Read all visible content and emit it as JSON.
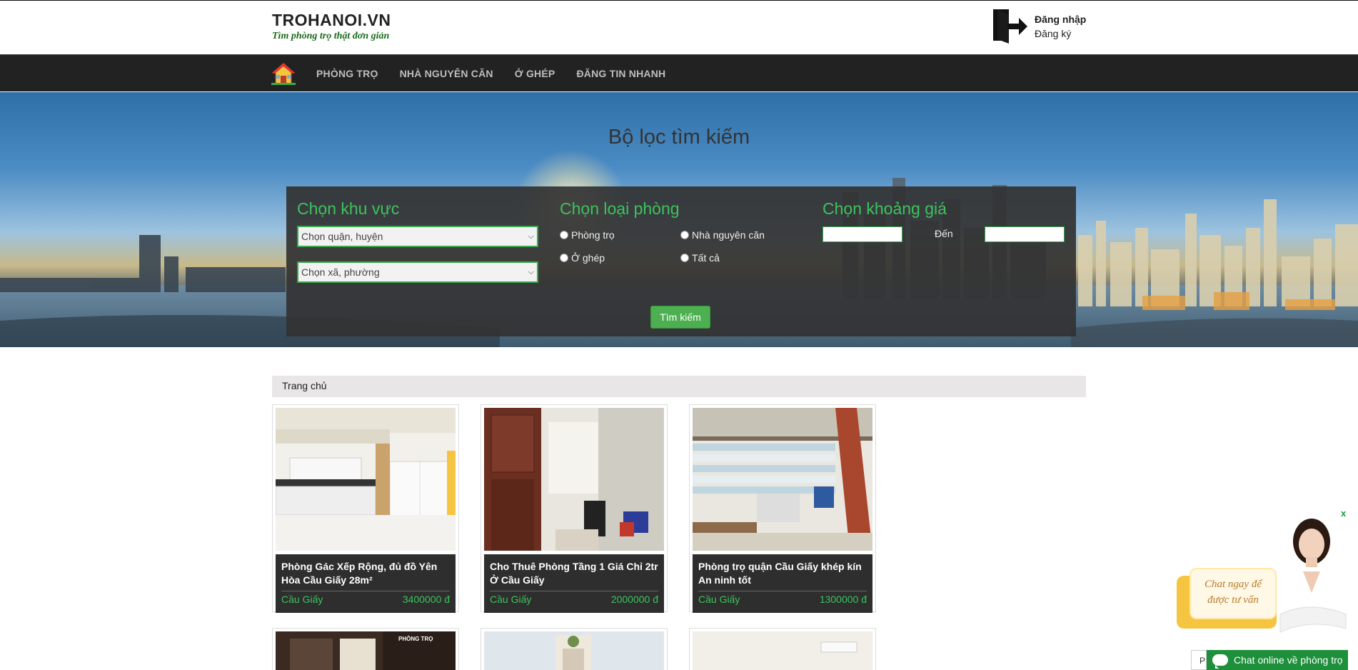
{
  "header": {
    "brand_name": "TROHANOI.VN",
    "brand_slogan": "Tìm phòng trọ thật đơn giản",
    "login_label": "Đăng nhập",
    "register_label": "Đăng ký"
  },
  "nav": {
    "home_icon": "house-icon",
    "items": [
      "PHÒNG TRỌ",
      "NHÀ NGUYÊN CĂN",
      "Ở GHÉP",
      "ĐĂNG TIN NHANH"
    ]
  },
  "filter": {
    "title": "Bộ lọc tìm kiếm",
    "area_heading": "Chọn khu vực",
    "district_select": "Chọn quận, huyện",
    "ward_select": "Chọn xã, phường",
    "room_type_heading": "Chọn loại phòng",
    "room_types": [
      "Phòng trọ",
      "Nhà nguyên căn",
      "Ở ghép",
      "Tất cả"
    ],
    "price_heading": "Chọn khoảng giá",
    "price_to_label": "Đến",
    "search_button": "Tìm kiếm"
  },
  "breadcrumb": {
    "home": "Trang chủ"
  },
  "listings": [
    {
      "title": "Phòng Gác Xếp Rộng, đủ đồ Yên Hòa Cầu Giấy 28m²",
      "district": "Cầu Giấy",
      "price": "3400000 đ"
    },
    {
      "title": "Cho Thuê Phòng Tầng 1 Giá Chỉ 2tr Ở Cầu Giấy",
      "district": "Cầu Giấy",
      "price": "2000000 đ"
    },
    {
      "title": "Phòng trọ quận Cầu Giấy khép kín An ninh tốt",
      "district": "Cầu Giấy",
      "price": "1300000 đ"
    }
  ],
  "second_row_photo_text": "PHÒNG TRỌ",
  "chat": {
    "close": "x",
    "bubble_text": "Chat ngay để được tư vấn",
    "online_label": "Chat online về phòng trọ",
    "p_label": "P"
  },
  "colors": {
    "accent_green": "#3cc35c",
    "nav_bg": "#222222",
    "panel_bg": "#323232",
    "button_green": "#4caf50"
  }
}
